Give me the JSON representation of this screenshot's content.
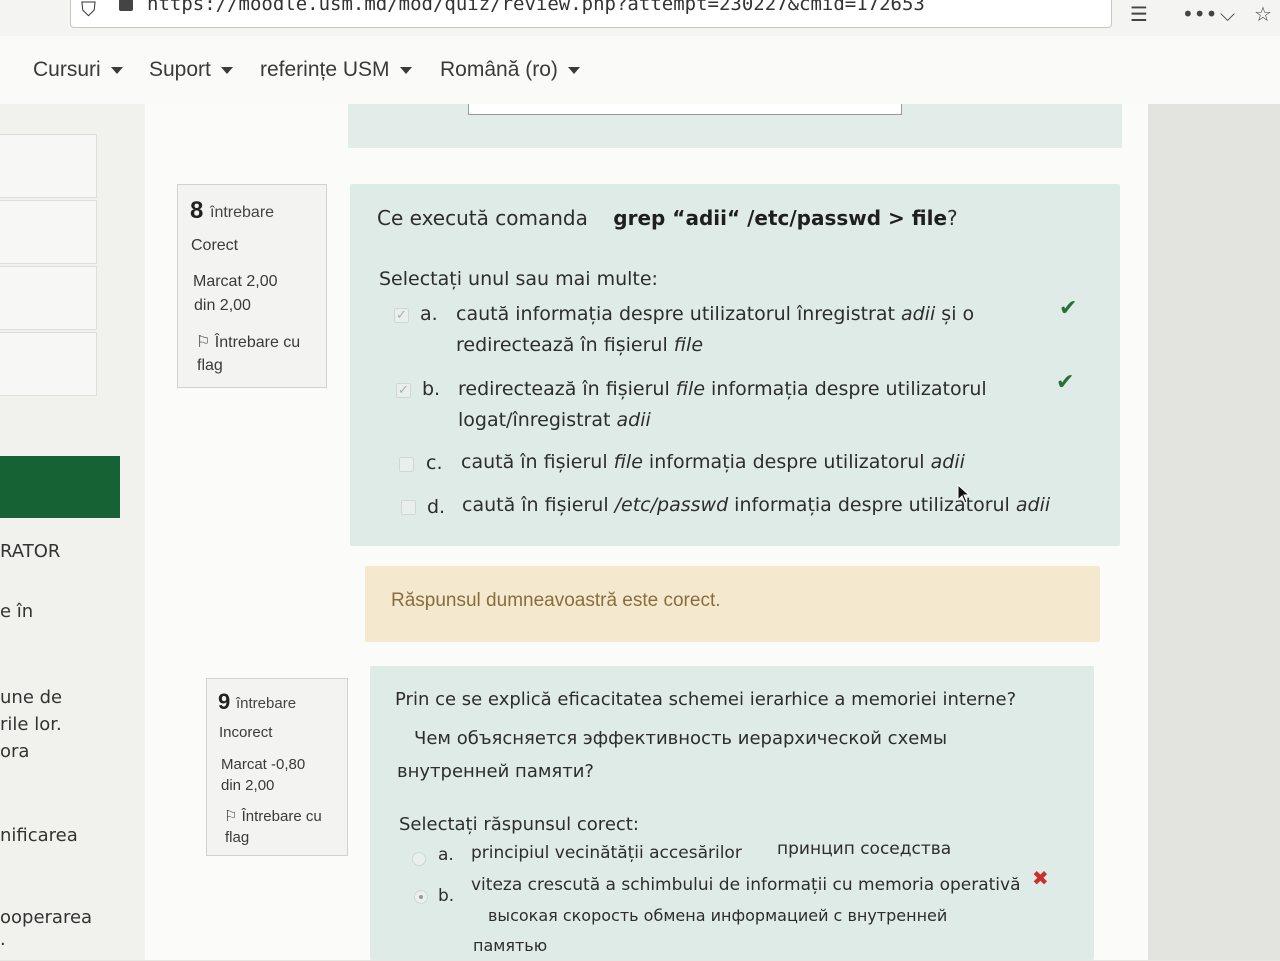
{
  "browser": {
    "url": "https://moodle.usm.md/mod/quiz/review.php?attempt=230227&cmid=172653"
  },
  "nav": {
    "items": [
      {
        "label": "Cursuri"
      },
      {
        "label": "Suport"
      },
      {
        "label": "referințe USM"
      },
      {
        "label": "Română (ro)"
      }
    ]
  },
  "sidebar": {
    "texts": [
      "RATOR",
      "e în",
      "une de",
      "rile lor.",
      "ora",
      "nificarea",
      "ooperarea",
      "."
    ]
  },
  "feedback": {
    "text": "Răspunsul dumneavoastră este corect."
  },
  "q8": {
    "number": "8",
    "word": "întrebare",
    "status": "Corect",
    "mark_line1": "Marcat 2,00",
    "mark_line2": "din 2,00",
    "flag_line1": "Întrebare cu",
    "flag_line2": "flag",
    "text_prefix": "Ce execută comanda",
    "command": "grep “adii“ /etc/passwd > file",
    "text_suffix": "?",
    "prompt": "Selectați unul sau mai multe:",
    "options": [
      {
        "letter": "a.",
        "parts": [
          "caută informația despre utilizatorul înregistrat ",
          "adii",
          " și o",
          "redirectează în fișierul ",
          "file"
        ]
      },
      {
        "letter": "b.",
        "parts": [
          "redirectează în fișierul ",
          "file",
          " informația despre utilizatorul",
          "logat/înregistrat ",
          "adii"
        ]
      },
      {
        "letter": "c.",
        "parts": [
          "caută în fișierul ",
          "file",
          " informația despre utilizatorul ",
          "adii"
        ]
      },
      {
        "letter": "d.",
        "parts": [
          "caută în fișierul ",
          "/etc/passwd",
          " informația despre utilizatorul ",
          "adii"
        ]
      }
    ]
  },
  "q9": {
    "number": "9",
    "word": "întrebare",
    "status": "Incorect",
    "mark_line1": "Marcat -0,80",
    "mark_line2": "din 2,00",
    "flag_line1": "Întrebare cu",
    "flag_line2": "flag",
    "text": "Prin ce se explică eficacitatea schemei ierarhice a memoriei interne?",
    "text_ru_1": "Чем объясняется эффективность иерархической схемы",
    "text_ru_2": "внутренней памяти?",
    "prompt": "Selectați răspunsul corect:",
    "options": [
      {
        "letter": "a.",
        "text": "principiul vecinătății accesărilor",
        "ru": "принцип соседства"
      },
      {
        "letter": "b.",
        "text": "viteza crescută a schimbului de informații cu memoria operativă",
        "ru_1": "высокая скорость обмена информацией с внутренней",
        "ru_2": "памятью"
      }
    ]
  }
}
